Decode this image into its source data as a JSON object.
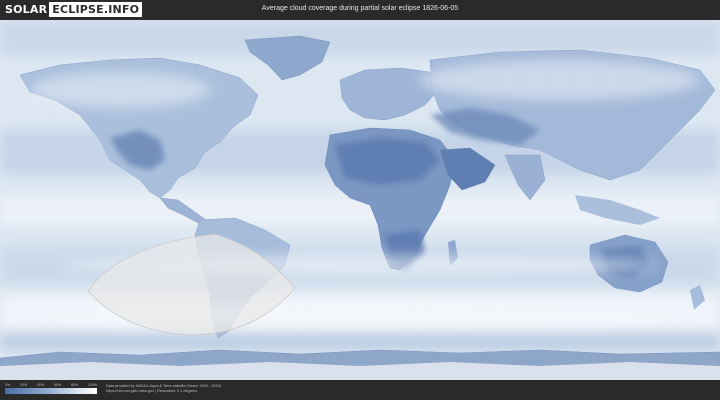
{
  "header": {
    "logo_solar": "SOLAR",
    "logo_eclipse": "ECLIPSE.INFO",
    "title": "Average cloud coverage during partial solar eclipse 1826-06-05"
  },
  "legend": {
    "ticks": [
      "0%",
      "20%",
      "40%",
      "60%",
      "80%",
      "100%"
    ],
    "colors": [
      "#4a6ea8",
      "#8fa9cf",
      "#dbe5f1",
      "#ffffff"
    ]
  },
  "credits": {
    "line1": "Data provided by NASA's Aqua & Terra satellite (Years: 2000 - 2019)",
    "line2": "https://neo.sci.gsfc.nasa.gov | Resolution: 0.1 degrees"
  },
  "map": {
    "ocean_color": "#d9e4f0",
    "land_color": "#a6bbd8",
    "dry_land_color": "#5f7fb2",
    "eclipse_zone_color": "#e6e6e6"
  }
}
